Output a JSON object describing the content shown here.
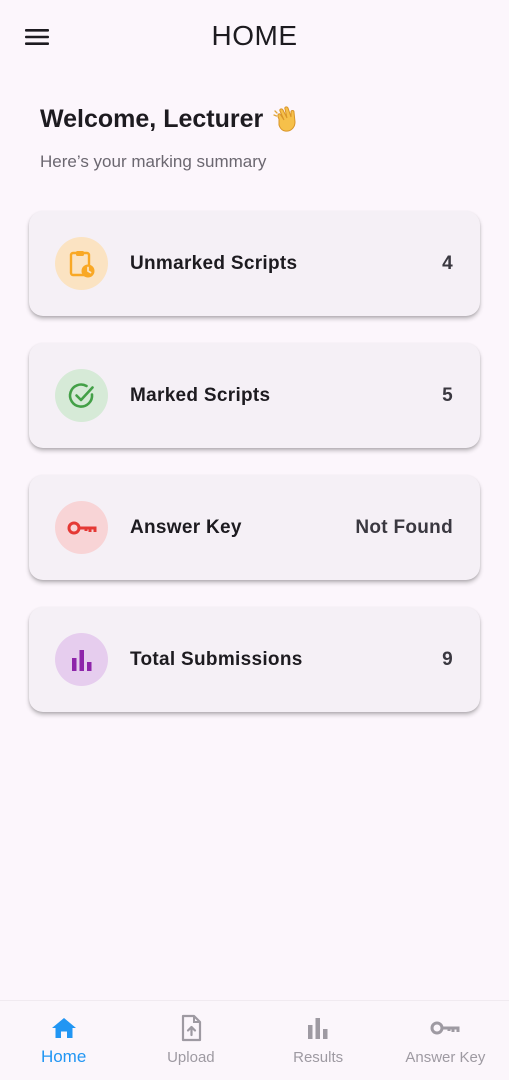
{
  "appbar": {
    "title": "HOME",
    "menu_icon": "menu-icon"
  },
  "welcome": {
    "title": "Welcome, Lecturer",
    "emoji": "waving-hand-icon",
    "subtitle": "Here’s your marking summary"
  },
  "cards": [
    {
      "label": "Unmarked Scripts",
      "value": "4",
      "icon": "pending-assignment-icon",
      "color": "#f9a825",
      "bg": "#fbe3c2"
    },
    {
      "label": "Marked Scripts",
      "value": "5",
      "icon": "check-circle-icon",
      "color": "#43a047",
      "bg": "#d6ead7"
    },
    {
      "label": "Answer Key",
      "value": "Not Found",
      "icon": "key-icon",
      "color": "#e53935",
      "bg": "#f8d4d6"
    },
    {
      "label": "Total Submissions",
      "value": "9",
      "icon": "bar-chart-icon",
      "color": "#8e24aa",
      "bg": "#e6cdee"
    }
  ],
  "bottom_nav": {
    "active_color": "#2196f3",
    "inactive_color": "#9e9aa2",
    "items": [
      {
        "label": "Home",
        "icon": "home-icon",
        "active": true
      },
      {
        "label": "Upload",
        "icon": "upload-file-icon",
        "active": false
      },
      {
        "label": "Results",
        "icon": "bar-chart-icon",
        "active": false
      },
      {
        "label": "Answer Key",
        "icon": "key-icon",
        "active": false
      }
    ]
  }
}
